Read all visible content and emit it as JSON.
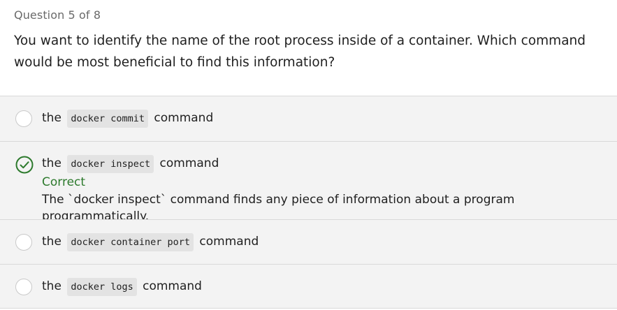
{
  "header": {
    "counter": "Question 5 of 8",
    "question": "You want to identify the name of the root process inside of a container. Which command would be most beneficial to find this information?"
  },
  "options": [
    {
      "prefix": "the",
      "code": "docker commit",
      "suffix": "command",
      "selected": false
    },
    {
      "prefix": "the",
      "code": "docker inspect",
      "suffix": "command",
      "selected": true,
      "result_label": "Correct",
      "explanation": "The `docker inspect` command finds any piece of information about a program programmatically."
    },
    {
      "prefix": "the",
      "code": "docker container port",
      "suffix": "command",
      "selected": false
    },
    {
      "prefix": "the",
      "code": "docker logs",
      "suffix": "command",
      "selected": false
    }
  ],
  "colors": {
    "correct": "#2d7a2d",
    "option_bg": "#f3f3f3",
    "divider": "#d9d9d9",
    "code_bg": "#e3e3e3"
  },
  "icons": {
    "selected": "check-circle-icon",
    "unselected": "radio-empty-icon"
  }
}
